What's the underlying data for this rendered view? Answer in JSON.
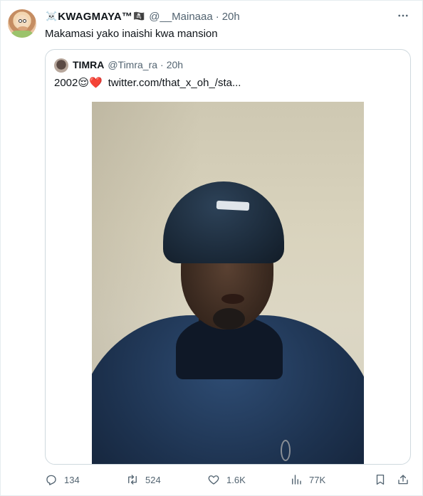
{
  "tweet": {
    "author": {
      "name_prefix_emoji": "☠️",
      "name": "KWAGMAYA™",
      "name_suffix_emoji": "🏴‍☠️",
      "handle": "@__Mainaaa",
      "time": "20h"
    },
    "text": "Makamasi yako inaishi kwa mansion",
    "more_icon": "more-horizontal-icon"
  },
  "quoted_tweet": {
    "author": {
      "name": "TIMRA",
      "handle": "@Timra_ra",
      "time": "20h"
    },
    "text": "2002",
    "text_emojis": "😌❤️",
    "link": "twitter.com/that_x_oh_/sta..."
  },
  "actions": {
    "reply_count": "134",
    "retweet_count": "524",
    "like_count": "1.6K",
    "views_count": "77K"
  },
  "separator_dot": "·"
}
